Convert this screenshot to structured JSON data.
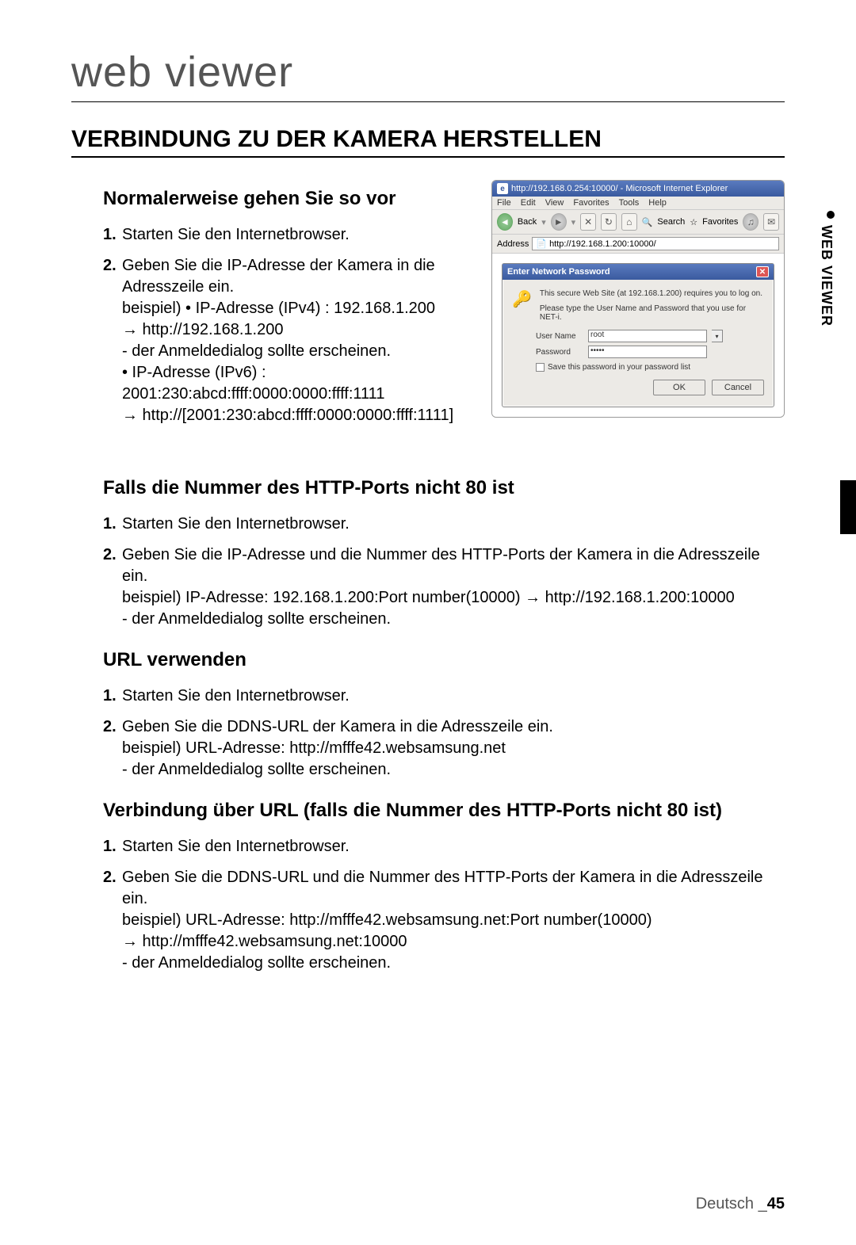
{
  "chapter": "web viewer",
  "section_title": "VERBINDUNG ZU DER KAMERA HERSTELLEN",
  "side_tab": "WEB VIEWER",
  "sub1": {
    "heading": "Normalerweise gehen Sie so vor",
    "step1_num": "1.",
    "step1": "Starten Sie den Internetbrowser.",
    "step2_num": "2.",
    "step2_l1": "Geben Sie die IP-Adresse der Kamera in die Adresszeile ein.",
    "step2_l2": "beispiel) • IP-Adresse (IPv4) : 192.168.1.200",
    "step2_l3": "→ http://192.168.1.200",
    "step2_l4": "- der Anmeldedialog sollte erscheinen.",
    "step2_l5": "• IP-Adresse (IPv6) : 2001:230:abcd:ffff:0000:0000:ffff:1111",
    "step2_l6": "→ http://[2001:230:abcd:ffff:0000:0000:ffff:1111]"
  },
  "sub2": {
    "heading": "Falls die Nummer des HTTP-Ports nicht 80 ist",
    "step1_num": "1.",
    "step1": "Starten Sie den Internetbrowser.",
    "step2_num": "2.",
    "step2_l1": "Geben Sie die IP-Adresse und die Nummer des HTTP-Ports der Kamera in die Adresszeile ein.",
    "step2_l2": "beispiel) IP-Adresse: 192.168.1.200:Port number(10000) → http://192.168.1.200:10000",
    "step2_l3": "- der Anmeldedialog sollte erscheinen."
  },
  "sub3": {
    "heading": "URL verwenden",
    "step1_num": "1.",
    "step1": "Starten Sie den Internetbrowser.",
    "step2_num": "2.",
    "step2_l1": "Geben Sie die DDNS-URL der Kamera in die Adresszeile ein.",
    "step2_l2": "beispiel) URL-Adresse: http://mfffe42.websamsung.net",
    "step2_l3": "- der Anmeldedialog sollte erscheinen."
  },
  "sub4": {
    "heading": "Verbindung über URL (falls die Nummer des HTTP-Ports nicht 80 ist)",
    "step1_num": "1.",
    "step1": "Starten Sie den Internetbrowser.",
    "step2_num": "2.",
    "step2_l1": "Geben Sie die DDNS-URL und die Nummer des HTTP-Ports der Kamera in die Adresszeile ein.",
    "step2_l2": "beispiel) URL-Adresse: http://mfffe42.websamsung.net:Port number(10000)",
    "step2_l3": "→ http://mfffe42.websamsung.net:10000",
    "step2_l4": "- der Anmeldedialog sollte erscheinen."
  },
  "browser": {
    "title": "http://192.168.0.254:10000/ - Microsoft Internet Explorer",
    "menus": [
      "File",
      "Edit",
      "View",
      "Favorites",
      "Tools",
      "Help"
    ],
    "back": "Back",
    "search": "Search",
    "favorites": "Favorites",
    "address_label": "Address",
    "address_value": "http://192.168.1.200:10000/"
  },
  "dialog": {
    "title": "Enter Network Password",
    "msg1": "This secure Web Site (at 192.168.1.200) requires you to log on.",
    "msg2": "Please type the User Name and Password that you use for NET-i.",
    "username_label": "User Name",
    "username_value": "root",
    "password_label": "Password",
    "password_value": "•••••",
    "save_label": "Save this password in your password list",
    "ok": "OK",
    "cancel": "Cancel"
  },
  "footer": {
    "lang": "Deutsch _",
    "page": "45"
  }
}
